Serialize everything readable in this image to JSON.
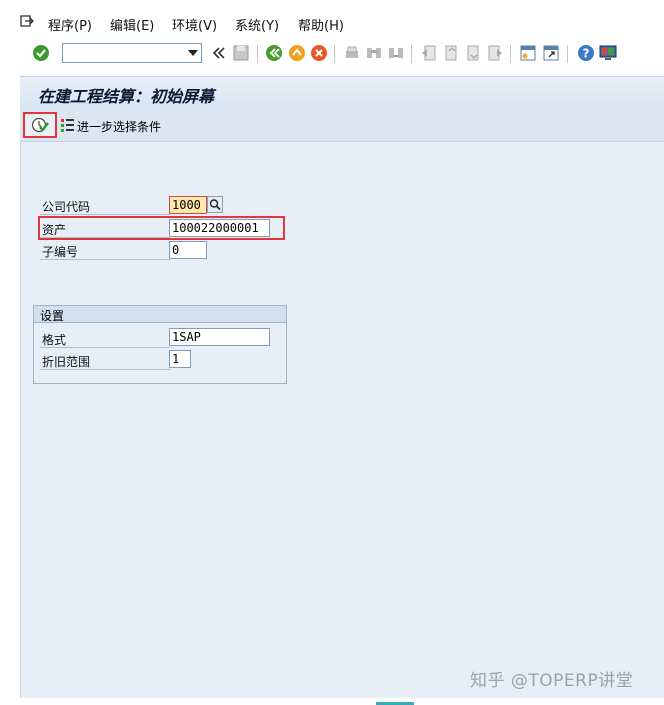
{
  "menubar": {
    "items": [
      "程序(P)",
      "编辑(E)",
      "环境(V)",
      "系统(Y)",
      "帮助(H)"
    ]
  },
  "toolbar": {
    "command_field_value": "",
    "icons": [
      "enter-icon",
      "back-double-icon",
      "save-icon",
      "back-icon",
      "exit-icon",
      "cancel-icon",
      "print-icon",
      "find-icon",
      "find-next-icon",
      "first-page-icon",
      "prev-page-icon",
      "next-page-icon",
      "last-page-icon",
      "new-session-icon",
      "shortcut-icon",
      "help-icon",
      "customize-layout-icon"
    ]
  },
  "title": "在建工程结算：初始屏幕",
  "app_toolbar": {
    "execute_icon": "execute-clock-icon",
    "more_selection_label": "进一步选择条件"
  },
  "fields": {
    "company_code": {
      "label": "公司代码",
      "value": "1000"
    },
    "asset": {
      "label": "资产",
      "value": "100022000001"
    },
    "subnumber": {
      "label": "子编号",
      "value": "0"
    }
  },
  "settings": {
    "group_title": "设置",
    "layout": {
      "label": "格式",
      "value": "1SAP"
    },
    "depreciation_area": {
      "label": "折旧范围",
      "value": "1"
    }
  },
  "watermark": "知乎 @TOPERP讲堂",
  "colors": {
    "highlight": "#e0363c",
    "title_bg": "#d7e4f1",
    "main_bg": "#e7eef6"
  }
}
